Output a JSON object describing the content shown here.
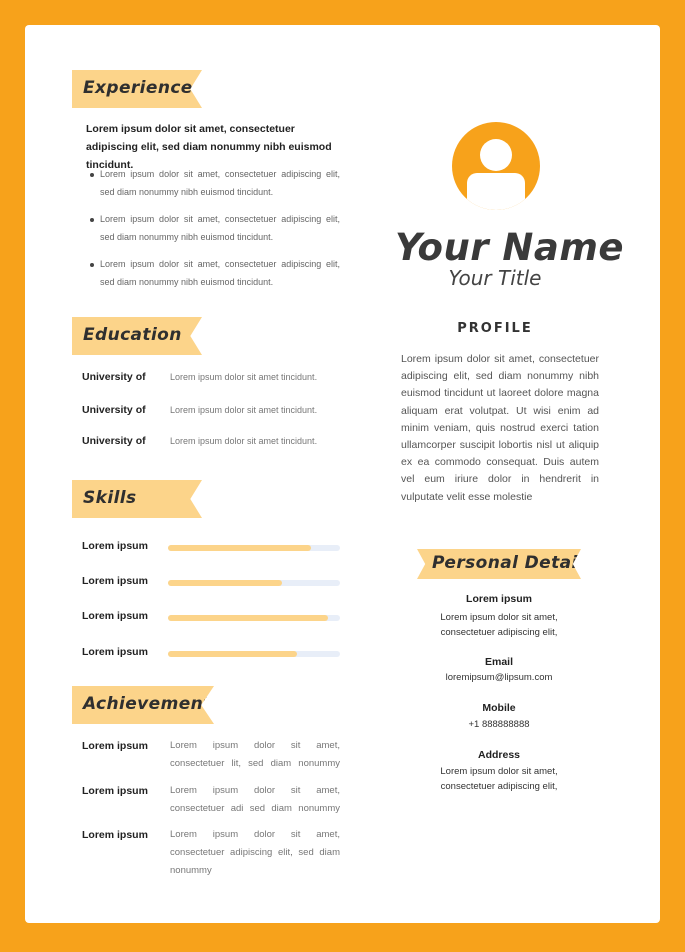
{
  "colors": {
    "background": "#f7a21b",
    "ribbon": "#fcd48a",
    "avatar": "#f7a21b",
    "bar_track": "#e8eef8"
  },
  "experience": {
    "heading": "Experience",
    "intro": "Lorem ipsum dolor sit amet, consectetuer adipiscing elit, sed diam nonummy nibh euismod tincidunt.",
    "bullets": [
      "Lorem ipsum dolor sit amet, consectetuer adipiscing elit, sed diam nonummy nibh euismod tincidunt.",
      "Lorem ipsum dolor sit amet, consectetuer adipiscing elit, sed diam nonummy nibh euismod tincidunt.",
      "Lorem ipsum dolor sit amet, consectetuer adipiscing elit, sed diam nonummy nibh euismod tincidunt."
    ]
  },
  "education": {
    "heading": "Education",
    "items": [
      {
        "school": "University of",
        "desc": "Lorem ipsum dolor sit amet tincidunt."
      },
      {
        "school": "University of",
        "desc": "Lorem ipsum dolor sit amet tincidunt."
      },
      {
        "school": "University of",
        "desc": "Lorem ipsum dolor sit amet tincidunt."
      }
    ]
  },
  "skills": {
    "heading": "Skills",
    "items": [
      {
        "label": "Lorem ipsum",
        "level": 0.83
      },
      {
        "label": "Lorem ipsum",
        "level": 0.66
      },
      {
        "label": "Lorem ipsum",
        "level": 0.93
      },
      {
        "label": "Lorem ipsum",
        "level": 0.75
      }
    ]
  },
  "achievement": {
    "heading": "Achievement",
    "items": [
      {
        "label": "Lorem ipsum",
        "text": "Lorem ipsum dolor sit amet, consectetuer lit, sed diam nonummy"
      },
      {
        "label": "Lorem ipsum",
        "text": "Lorem ipsum dolor sit amet, consectetuer adi sed diam nonummy"
      },
      {
        "label": "Lorem ipsum",
        "text": "Lorem ipsum dolor sit amet, consectetuer adipiscing elit, sed diam nonummy"
      }
    ]
  },
  "header": {
    "name": "Your Name",
    "title": "Your Title",
    "avatar_icon": "user-avatar-icon"
  },
  "profile": {
    "heading": "PROFILE",
    "text": "Lorem ipsum dolor sit amet, consectetuer adipiscing elit, sed diam nonummy nibh euismod tincidunt ut laoreet dolore magna aliquam erat volutpat. Ut wisi enim ad minim veniam, quis nostrud exerci tation ullamcorper suscipit lobortis nisl ut aliquip ex ea commodo consequat. Duis autem vel eum iriure dolor in hendrerit in vulputate velit esse molestie"
  },
  "personal": {
    "heading": "Personal Details",
    "name_label": "Lorem ipsum",
    "name_line1": "Lorem ipsum dolor sit amet,",
    "name_line2": "consectetuer adipiscing elit,",
    "email_label": "Email",
    "email": "loremipsum@lipsum.com",
    "mobile_label": "Mobile",
    "mobile": "+1 888888888",
    "address_label": "Address",
    "address_line1": "Lorem ipsum dolor sit amet,",
    "address_line2": "consectetuer adipiscing elit,"
  }
}
